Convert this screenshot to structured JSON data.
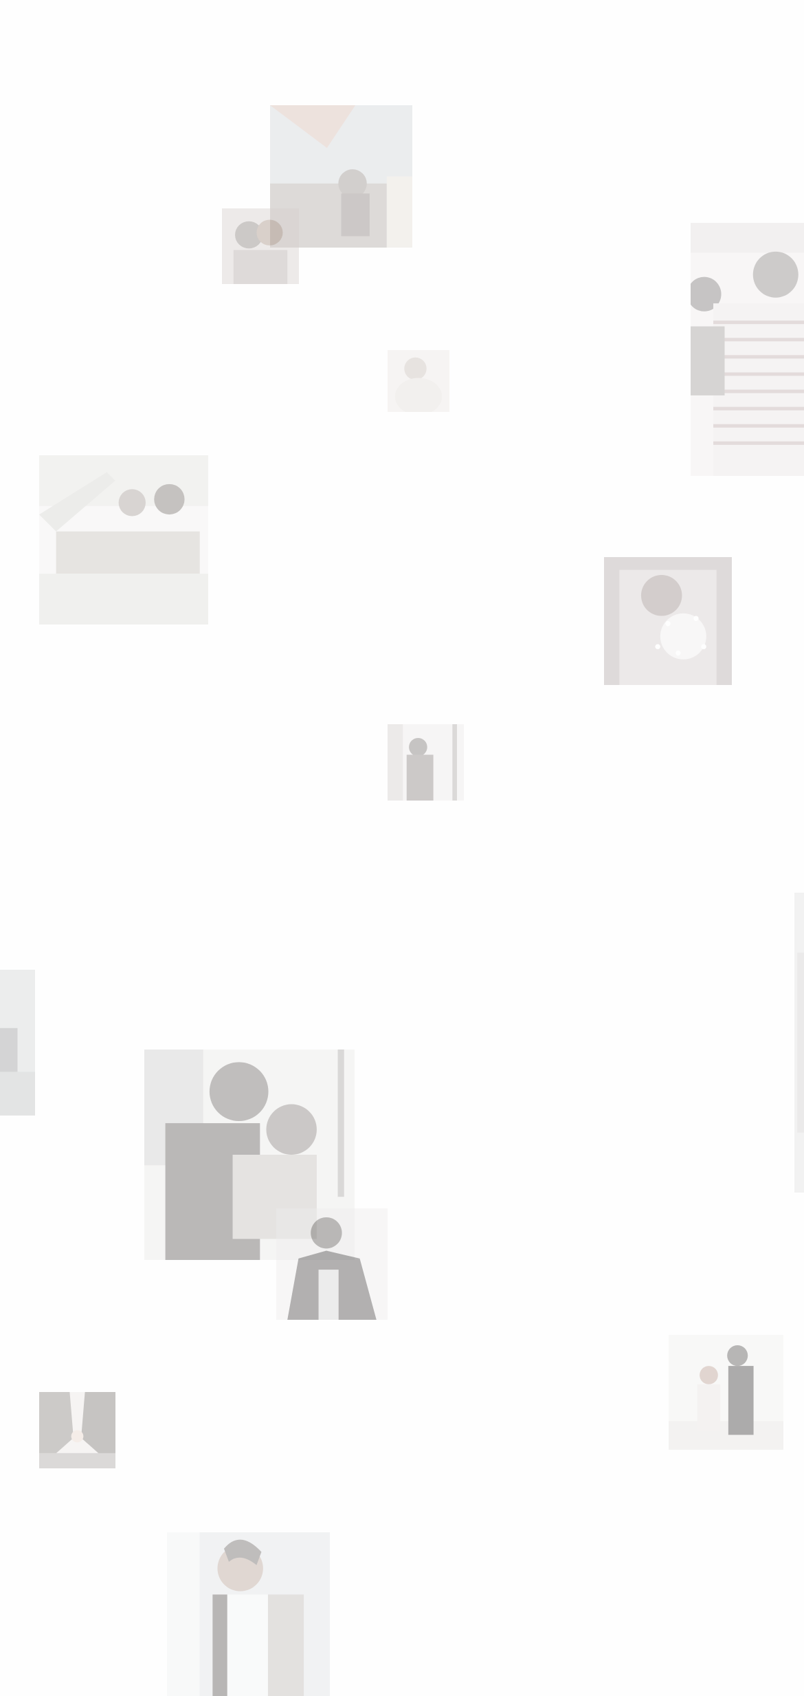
{
  "page": {
    "background": "#fefefe"
  },
  "photos": [
    {
      "key": "balloon",
      "icon": "hot-air-balloon-couple-photo",
      "palette": [
        "#cfd6dc",
        "#b7a9a0",
        "#e8e0cf"
      ]
    },
    {
      "key": "couple-a",
      "icon": "couple-embrace-photo",
      "palette": [
        "#d9cfcb",
        "#b9aaa3",
        "#efe7e2"
      ]
    },
    {
      "key": "hug-small",
      "icon": "couple-hug-photo",
      "palette": [
        "#e7dcd6",
        "#cdbdb4",
        "#f3ece6"
      ]
    },
    {
      "key": "striped",
      "icon": "striped-shirt-couple-photo",
      "palette": [
        "#e6dcdc",
        "#b8afad",
        "#f1eded"
      ]
    },
    {
      "key": "car",
      "icon": "convertible-couple-photo",
      "palette": [
        "#e4e2dc",
        "#c9c0b7",
        "#f3f2ee"
      ]
    },
    {
      "key": "sparkler",
      "icon": "sparkler-woman-photo",
      "palette": [
        "#b9a9a9",
        "#d9cccc",
        "#f3eeee"
      ]
    },
    {
      "key": "window",
      "icon": "couple-window-photo",
      "palette": [
        "#d7cfcd",
        "#b1a6a3",
        "#efeae8"
      ]
    },
    {
      "key": "left-edge",
      "icon": "partial-photo-left",
      "palette": [
        "#d4d6d8",
        "#bfc1c3",
        "#e9eaeb"
      ]
    },
    {
      "key": "right-edge",
      "icon": "partial-photo-right",
      "palette": [
        "#e3e2e2",
        "#d1d0d0",
        "#efefef"
      ]
    },
    {
      "key": "kiss-city",
      "icon": "couple-kiss-street-photo",
      "palette": [
        "#cfcdcc",
        "#a9a4a2",
        "#ece9e6"
      ]
    },
    {
      "key": "man-jacket",
      "icon": "man-leather-jacket-photo",
      "palette": [
        "#d6d4d4",
        "#a9a6a6",
        "#eeeded"
      ]
    },
    {
      "key": "beach",
      "icon": "beach-couple-photo",
      "palette": [
        "#e5e2df",
        "#bcb7b4",
        "#f2f0ee"
      ]
    },
    {
      "key": "kiss-sun",
      "icon": "couple-kiss-sunset-photo",
      "palette": [
        "#d3ccc8",
        "#b0a6a1",
        "#efe7e1"
      ]
    },
    {
      "key": "smile-girl",
      "icon": "smiling-girl-selfie-photo",
      "palette": [
        "#dfe3e6",
        "#c2b9b3",
        "#f1f3f4"
      ]
    }
  ]
}
